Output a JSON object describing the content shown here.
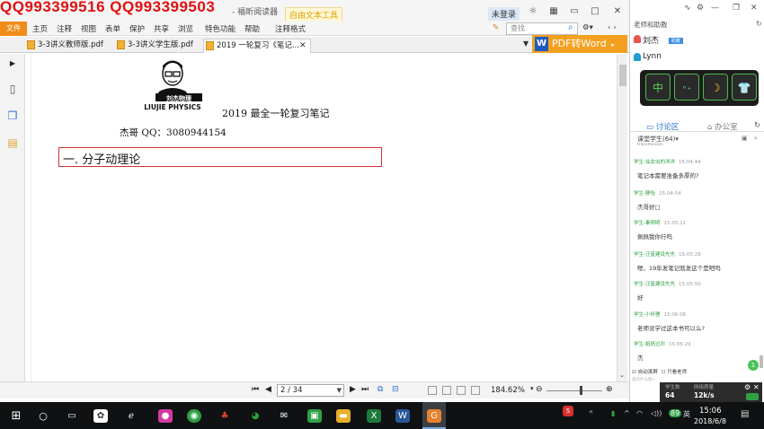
{
  "watermark": "QQ993399516  QQ993399503",
  "window": {
    "app_title": "- 福昕阅读器",
    "context_tab": "自由文本工具",
    "login": "未登录"
  },
  "menu": {
    "file": "文件",
    "items": [
      "主页",
      "注释",
      "视图",
      "表单",
      "保护",
      "共享",
      "浏览",
      "特色功能",
      "帮助",
      "注释格式"
    ],
    "search_placeholder": "查找"
  },
  "tabs": [
    {
      "label": "3-3讲义教师版.pdf"
    },
    {
      "label": "3-3讲义学生版.pdf"
    },
    {
      "label": "2019 一轮复习《笔记..."
    }
  ],
  "pdf_to_word": "PDF转Word",
  "document": {
    "logo_text": "LIUJIE PHYSICS",
    "logo_cn": "刘杰物理",
    "title": "2019 最全一轮复习笔记",
    "qq_line": "杰哥 QQ：3080944154",
    "heading": "一. 分子动理论"
  },
  "status": {
    "page_display": "2 / 34",
    "zoom": "184.62%"
  },
  "panel": {
    "teacher_label": "老师和助教",
    "users": [
      {
        "name": "刘杰",
        "badge": "助教"
      },
      {
        "name": "Lynn",
        "badge": ""
      }
    ],
    "tool_icons": [
      "中",
      "∘₊",
      "☽",
      "👕"
    ],
    "tabs": {
      "discussion": "讨论区",
      "office": "办公室"
    },
    "chat_filter": "课堂学生(64)▾",
    "chat_sub": "transmission",
    "messages": [
      {
        "sender": "学生-仙女似的洋洋",
        "time": "15:04:44",
        "text": "笔记本需要准备多厚的?"
      },
      {
        "sender": "学生-静怡",
        "time": "15:04:54",
        "text": "杰哥好□"
      },
      {
        "sender": "学生-秦明明",
        "time": "15:05:11",
        "text": "佩佩我你行吗"
      },
      {
        "sender": "学生-汪星建设先先",
        "time": "15:05:29",
        "text": "嗯，19年发笔记就发这个是吧吗"
      },
      {
        "sender": "学生-汪星建设先先",
        "time": "15:05:50",
        "text": "好"
      },
      {
        "sender": "学生-小伴狸",
        "time": "15:06:06",
        "text": "老师没学过这本书可以么?"
      },
      {
        "sender": "学生-姐妈过邓",
        "time": "15:06:29",
        "text": "杰"
      }
    ],
    "options": {
      "auto_scroll": "自动滚屏",
      "teacher_only": "只看老师"
    },
    "input_placeholder": "说点什么吧~",
    "stats": {
      "students_label": "学生数",
      "students": "64",
      "bandwidth_label": "网络质量",
      "bandwidth": "12k/s"
    },
    "unread": "1"
  },
  "taskbar": {
    "time": "15:06",
    "date": "2018/6/8",
    "lang": "英",
    "badge": "89"
  }
}
